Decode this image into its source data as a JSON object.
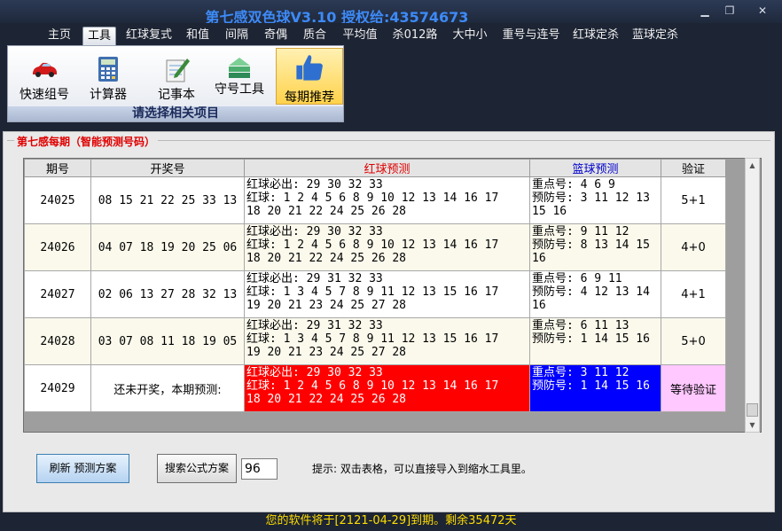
{
  "window": {
    "title": "第七感双色球V3.10  授权给:43574673",
    "min_glyph": "▁",
    "max_glyph": "❐",
    "close_glyph": "✕"
  },
  "menu": [
    {
      "label": "主页",
      "active": false
    },
    {
      "label": "工具",
      "active": true
    },
    {
      "label": "红球复式",
      "active": false
    },
    {
      "label": "和值",
      "active": false
    },
    {
      "label": "间隔",
      "active": false
    },
    {
      "label": "奇偶",
      "active": false
    },
    {
      "label": "质合",
      "active": false
    },
    {
      "label": "平均值",
      "active": false
    },
    {
      "label": "杀012路",
      "active": false
    },
    {
      "label": "大中小",
      "active": false
    },
    {
      "label": "重号与连号",
      "active": false
    },
    {
      "label": "红球定杀",
      "active": false
    },
    {
      "label": "蓝球定杀",
      "active": false
    }
  ],
  "ribbon": {
    "caption": "请选择相关项目",
    "buttons": [
      {
        "label": "快速组号",
        "icon": "car-icon"
      },
      {
        "label": "计算器",
        "icon": "calculator-icon"
      },
      {
        "label": "记事本",
        "icon": "notepad-icon"
      },
      {
        "label": "守号工具",
        "icon": "stack-icon"
      },
      {
        "label": "每期推荐",
        "icon": "thumbs-up-icon"
      }
    ]
  },
  "group_title": "第七感每期（智能预测号码）",
  "table": {
    "headers": [
      "期号",
      "开奖号",
      "红球预测",
      "篮球预测",
      "验证"
    ],
    "header_colors": {
      "red": "#e00000",
      "blue": "#0000cc"
    },
    "rows": [
      {
        "period": "24025",
        "draw": "08 15 21 22 25 33 13",
        "red": [
          "红球必出: 29 30 32 33",
          "红球: 1 2 4 5 6 8 9 10 12 13 14 16 17",
          "18 20 21 22 24 25 26 28"
        ],
        "blue": [
          "重点号: 4 6 9",
          "预防号: 3 11 12 13",
          "15 16"
        ],
        "verify": "5+1"
      },
      {
        "period": "24026",
        "draw": "04 07 18 19 20 25 06",
        "red": [
          "红球必出: 29 30 32 33",
          "红球: 1 2 4 5 6 8 9 10 12 13 14 16 17",
          "18 20 21 22 24 25 26 28"
        ],
        "blue": [
          "重点号: 9 11 12",
          "预防号: 8 13 14 15",
          "16"
        ],
        "verify": "4+0"
      },
      {
        "period": "24027",
        "draw": "02 06 13 27 28 32 13",
        "red": [
          "红球必出: 29 31 32 33",
          "红球: 1 3 4 5 7 8 9 11 12 13 15 16 17",
          "19 20 21 23 24 25 27 28"
        ],
        "blue": [
          "重点号: 6 9 11",
          "预防号: 4 12 13 14",
          "16"
        ],
        "verify": "4+1"
      },
      {
        "period": "24028",
        "draw": "03 07 08 11 18 19 05",
        "red": [
          "红球必出: 29 31 32 33",
          "红球: 1 3 4 5 7 8 9 11 12 13 15 16 17",
          "19 20 21 23 24 25 27 28"
        ],
        "blue": [
          "重点号: 6 11 13",
          "预防号: 1 14 15 16",
          ""
        ],
        "verify": "5+0"
      },
      {
        "period": "24029",
        "draw": "还未开奖，本期预测:",
        "red": [
          "红球必出: 29 30 32 33",
          "红球: 1 2 4 5 6 8 9 10 12 13 14 16 17",
          "18 20 21 22 24 25 26 28"
        ],
        "blue": [
          "重点号: 3 11 12",
          "预防号: 1 14 15 16",
          ""
        ],
        "verify": "等待验证"
      }
    ]
  },
  "controls": {
    "refresh_label": "刷新 预测方案",
    "search_label": "搜索公式方案",
    "number_value": "96",
    "hint": "提示: 双击表格，可以直接导入到缩水工具里。"
  },
  "status": "您的软件将于[2121-04-29]到期。剩余35472天"
}
